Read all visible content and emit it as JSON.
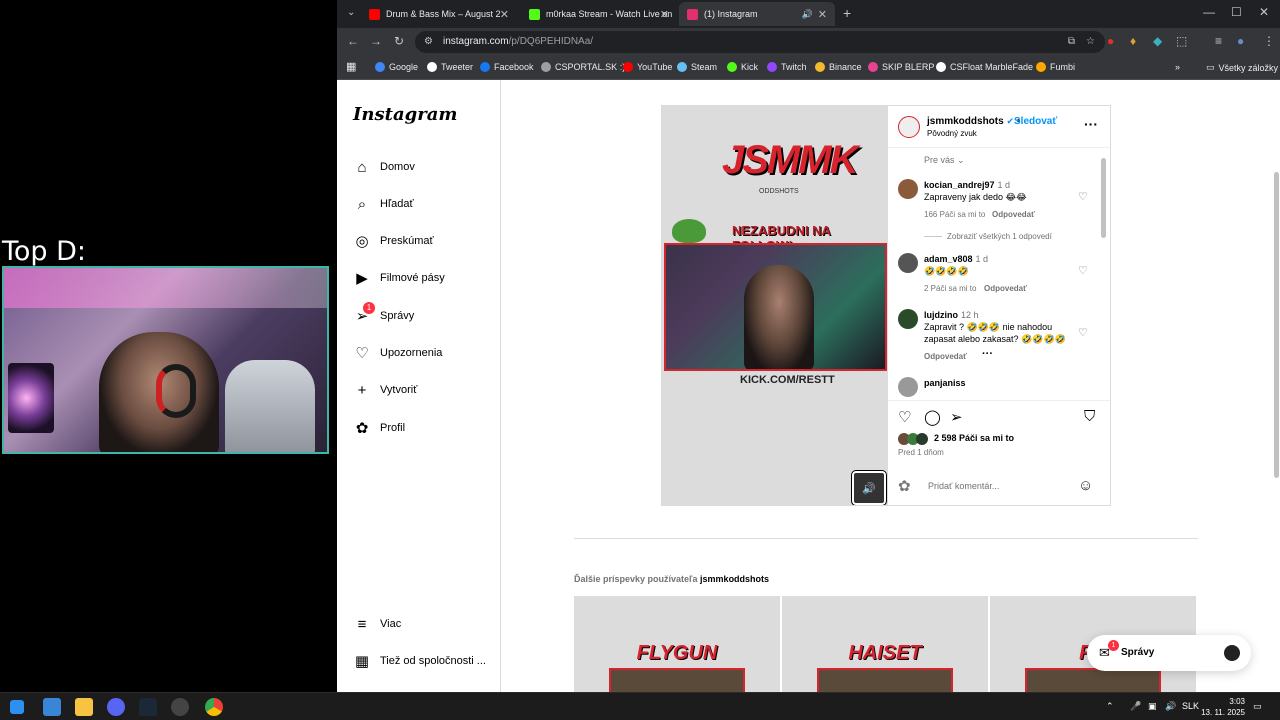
{
  "overlay": {
    "label": "Top D:"
  },
  "tabs": [
    {
      "title": "Drum & Bass Mix – August 2",
      "favicon_color": "#ff0000"
    },
    {
      "title": "m0rkaa Stream - Watch Live on",
      "favicon_color": "#53fc18"
    },
    {
      "title": "(1) Instagram",
      "favicon_color": "#e1306c"
    }
  ],
  "address": {
    "host": "instagram.com",
    "path": "/p/DQ6PEHIDNAa/"
  },
  "bookmarks": [
    {
      "label": "Google",
      "color": "#4285f4"
    },
    {
      "label": "Tweeter",
      "color": "#ffffff"
    },
    {
      "label": "Facebook",
      "color": "#1877f2"
    },
    {
      "label": "CSPORTAL.SK :)",
      "color": "#9aa0a6"
    },
    {
      "label": "YouTube",
      "color": "#ff0000"
    },
    {
      "label": "Steam",
      "color": "#66c0f4"
    },
    {
      "label": "Kick",
      "color": "#53fc18"
    },
    {
      "label": "Twitch",
      "color": "#9146ff"
    },
    {
      "label": "Binance",
      "color": "#f3ba2f"
    },
    {
      "label": "SKIP BLERP",
      "color": "#e84393"
    },
    {
      "label": "CSFloat MarbleFade",
      "color": "#ffffff"
    },
    {
      "label": "Fumbi",
      "color": "#ffa800"
    }
  ],
  "bookmarks_all": "Všetky záložky",
  "instagram": {
    "logo": "Instagram",
    "nav": [
      {
        "label": "Domov",
        "icon": "home-icon"
      },
      {
        "label": "Hľadať",
        "icon": "search-icon"
      },
      {
        "label": "Preskúmať",
        "icon": "compass-icon"
      },
      {
        "label": "Filmové pásy",
        "icon": "reels-icon"
      },
      {
        "label": "Správy",
        "icon": "messenger-icon",
        "badge": "1"
      },
      {
        "label": "Upozornenia",
        "icon": "heart-icon"
      },
      {
        "label": "Vytvoriť",
        "icon": "plus-icon"
      },
      {
        "label": "Profil",
        "icon": "profile-icon"
      }
    ],
    "nav_bottom": [
      {
        "label": "Viac",
        "icon": "menu-icon"
      },
      {
        "label": "Tiež od spoločnosti ...",
        "icon": "meta-icon"
      }
    ],
    "video": {
      "brand": "JSMMK",
      "brand_sub": "ODDSHOTS",
      "follow_text": "NEZABUDNI NA FOLLOW!",
      "kick_text": "KICK.COM/RESTT"
    },
    "post": {
      "username": "jsmmkoddshots",
      "follow": "Sledovať",
      "audio": "Pôvodný zvuk",
      "sort": "Pre vás",
      "comments": [
        {
          "user": "kocian_andrej97",
          "time": "1 d",
          "text": "Zapraveny jak dedo 😂😂",
          "meta": "166 Páči sa mi to",
          "reply": "Odpovedať",
          "avatar_color": "#8a5a3a"
        },
        {
          "user": "adam_v808",
          "time": "1 d",
          "text": "🤣🤣🤣🤣",
          "meta": "2 Páči sa mi to",
          "reply": "Odpovedať",
          "avatar_color": "#555555"
        },
        {
          "user": "lujdzino",
          "time": "12 h",
          "text": "Zapravit ? 🤣🤣🤣 nie nahodou",
          "text2": "zapasat alebo zakasat? 🤣🤣🤣🤣",
          "meta": "",
          "reply": "Odpovedať",
          "avatar_color": "#2a4a2a"
        },
        {
          "user": "panjaniss",
          "time": "",
          "text": "",
          "meta": "",
          "reply": "",
          "avatar_color": "#999999"
        }
      ],
      "view_replies": "Zobraziť všetkých 1 odpovedí",
      "likes": "2 598 Páči sa mi to",
      "posted": "Pred 1 dňom",
      "add_comment": "Pridať komentár..."
    },
    "more_posts_prefix": "Ďalšie príspevky používateľa",
    "more_posts_user": "jsmmkoddshots",
    "thumbs": [
      {
        "title": "FLYGUN"
      },
      {
        "title": "HAISET"
      },
      {
        "title": "RE"
      }
    ],
    "messages_pill": {
      "label": "Správy",
      "badge": "1"
    }
  },
  "taskbar": {
    "lang": "SLK",
    "time": "3:03",
    "date": "13. 11. 2025"
  }
}
